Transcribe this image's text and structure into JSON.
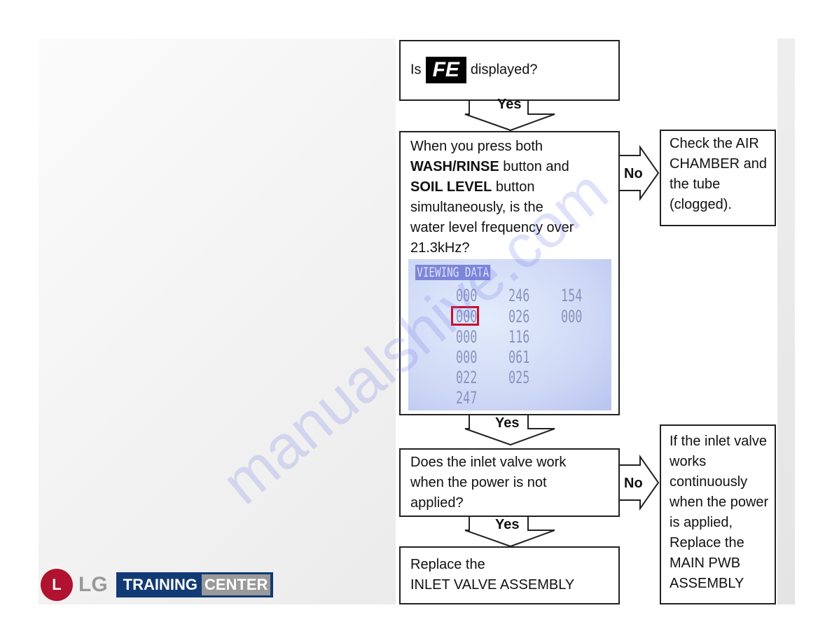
{
  "watermark": "manualshive.com",
  "flowchart": {
    "q1": {
      "prefix": "Is",
      "code": "FE",
      "suffix": "displayed?"
    },
    "q2": {
      "l1": "When you press both",
      "b1": "WASH/RINSE",
      "l2": " button and",
      "b2": "SOIL LEVEL",
      "l3": " button",
      "l4": "simultaneously, is the",
      "l5": "water level frequency over",
      "l6": "21.3kHz?"
    },
    "no1": "Check the AIR CHAMBER and the tube (clogged).",
    "q3": "Does the inlet valve work when the power is not applied?",
    "no2": "If the inlet valve works continuously when the power is applied, Replace the MAIN PWB ASSEMBLY",
    "end": {
      "l1": "Replace the",
      "l2": "INLET VALVE ASSEMBLY"
    },
    "yes_label": "Yes",
    "no_label": "No"
  },
  "lcd": {
    "title": "VIEWING DATA",
    "col1": [
      "000",
      "000",
      "000",
      "000",
      "022",
      "247"
    ],
    "col2": [
      "246",
      "026",
      "116",
      "061",
      "025"
    ],
    "col3": [
      "154",
      "000"
    ],
    "highlight_color": "#c8102e"
  },
  "logo": {
    "brand": "LG",
    "training": "TRAINING",
    "center": "CENTER"
  }
}
